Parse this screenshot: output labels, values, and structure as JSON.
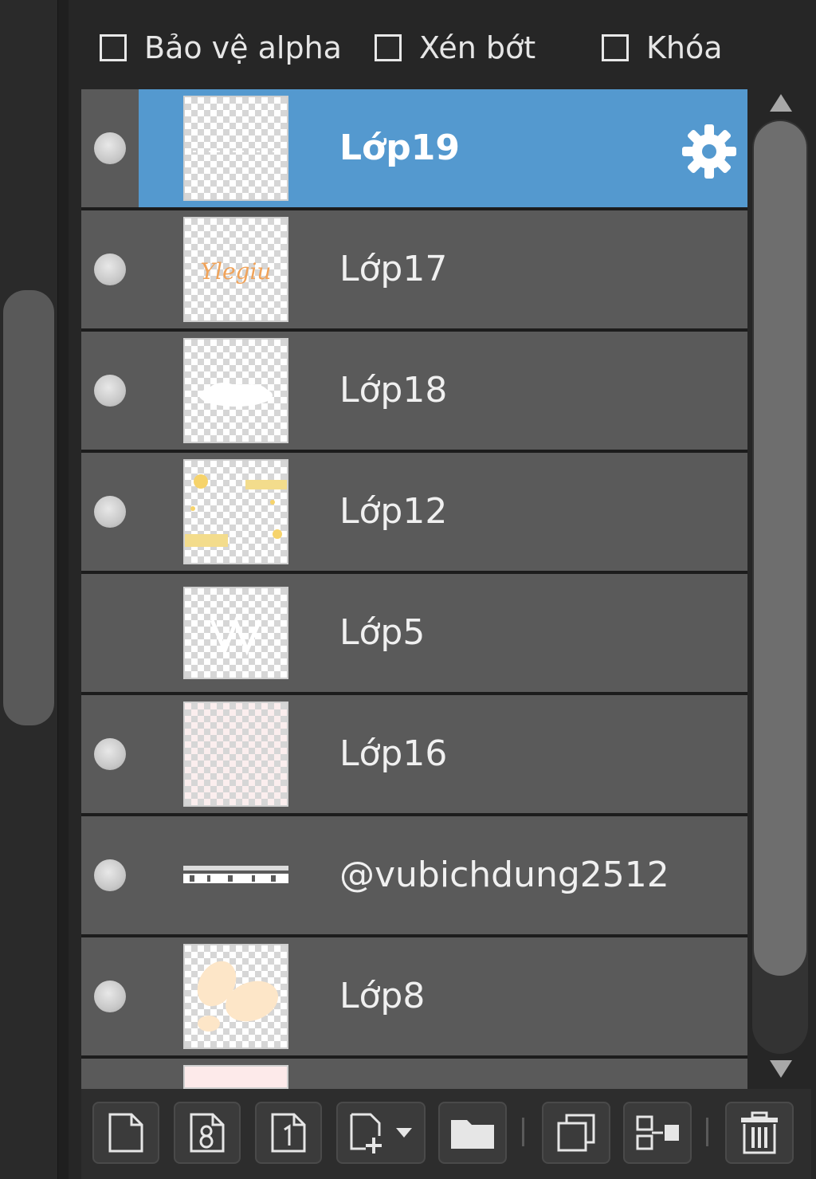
{
  "options": {
    "alpha_protect": {
      "label": "Bảo vệ alpha",
      "checked": false
    },
    "clip": {
      "label": "Xén bớt",
      "checked": false
    },
    "lock": {
      "label": "Khóa",
      "checked": false
    }
  },
  "layers": [
    {
      "name": "Lớp19",
      "visible": true,
      "selected": true
    },
    {
      "name": "Lớp17",
      "visible": true,
      "selected": false
    },
    {
      "name": "Lớp18",
      "visible": true,
      "selected": false
    },
    {
      "name": "Lớp12",
      "visible": true,
      "selected": false
    },
    {
      "name": "Lớp5",
      "visible": false,
      "selected": false
    },
    {
      "name": "Lớp16",
      "visible": true,
      "selected": false
    },
    {
      "name": "@vubichdung2512",
      "visible": true,
      "selected": false
    },
    {
      "name": "Lớp8",
      "visible": true,
      "selected": false
    }
  ],
  "thumbnails": {
    "layer17_text": "Ylegiu"
  },
  "colors": {
    "selected": "#5499cf",
    "row": "#5a5a5a",
    "background": "#262626"
  },
  "toolbar": {
    "buttons": [
      "new-layer-icon",
      "new-8bit-layer-icon",
      "new-1bit-layer-icon",
      "add-layer-dropdown-icon",
      "new-folder-icon",
      "duplicate-layer-icon",
      "merge-down-icon",
      "delete-layer-icon"
    ]
  }
}
